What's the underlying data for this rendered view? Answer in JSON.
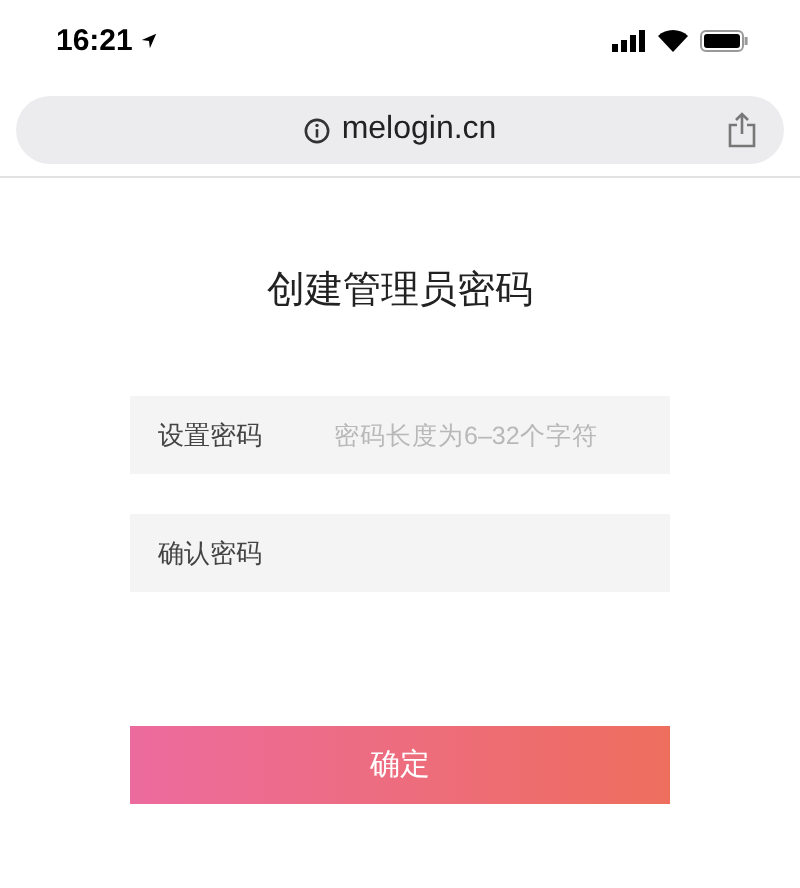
{
  "status_bar": {
    "time": "16:21"
  },
  "address_bar": {
    "url": "melogin.cn"
  },
  "page": {
    "title": "创建管理员密码",
    "fields": [
      {
        "label": "设置密码",
        "placeholder": "密码长度为6–32个字符"
      },
      {
        "label": "确认密码"
      }
    ],
    "submit": "确定"
  }
}
